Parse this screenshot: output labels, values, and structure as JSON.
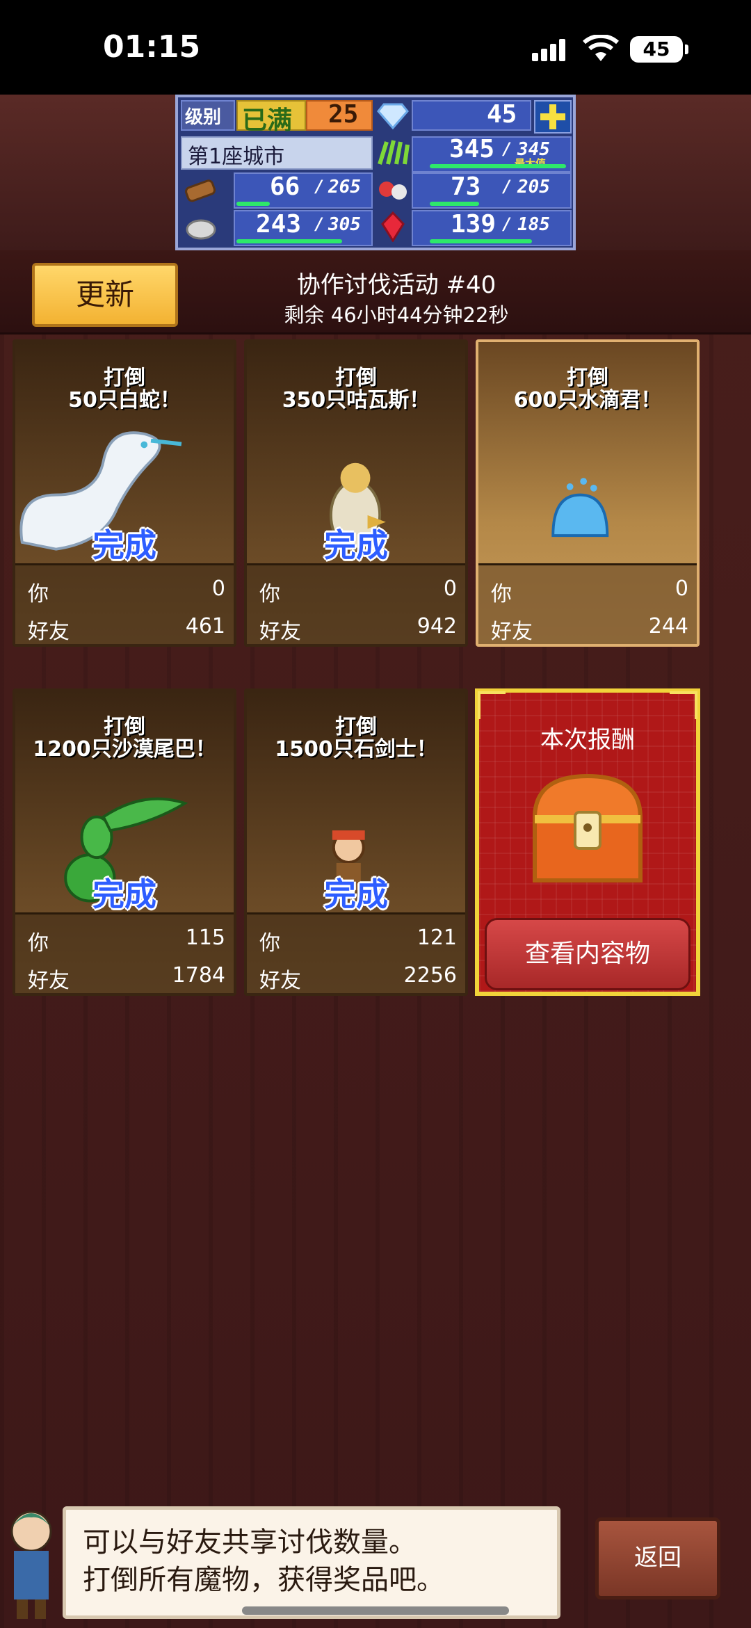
{
  "status_bar": {
    "time": "01:15",
    "battery": "45"
  },
  "resources": {
    "level_label": "级别",
    "level_max_label": "已满",
    "level_value": "25",
    "gems": "45",
    "city_name": "第1座城市",
    "food": {
      "value": "345",
      "max": "345",
      "max_label": "最大值",
      "fill": 1.0
    },
    "wood": {
      "value": "66",
      "max": "265",
      "fill": 0.25
    },
    "fruit": {
      "value": "73",
      "max": "205",
      "fill": 0.36
    },
    "stone": {
      "value": "243",
      "max": "305",
      "fill": 0.8
    },
    "crystal": {
      "value": "139",
      "max": "185",
      "fill": 0.75
    }
  },
  "event": {
    "refresh_label": "更新",
    "title": "协作讨伐活动 #40",
    "timer": "剩余 46小时44分钟22秒"
  },
  "cards": [
    {
      "line1": "打倒",
      "line2": "50只白蛇！",
      "done": "完成",
      "you_label": "你",
      "you": "0",
      "friend_label": "好友",
      "friend": "461"
    },
    {
      "line1": "打倒",
      "line2": "350只咕瓦斯！",
      "done": "完成",
      "you_label": "你",
      "you": "0",
      "friend_label": "好友",
      "friend": "942"
    },
    {
      "line1": "打倒",
      "line2": "600只水滴君！",
      "done": "",
      "you_label": "你",
      "you": "0",
      "friend_label": "好友",
      "friend": "244"
    },
    {
      "line1": "打倒",
      "line2": "1200只沙漠尾巴！",
      "done": "完成",
      "you_label": "你",
      "you": "115",
      "friend_label": "好友",
      "friend": "1784"
    },
    {
      "line1": "打倒",
      "line2": "1500只石剑士！",
      "done": "完成",
      "you_label": "你",
      "you": "121",
      "friend_label": "好友",
      "friend": "2256"
    }
  ],
  "reward": {
    "title": "本次报酬",
    "button": "查看内容物"
  },
  "message": {
    "line1": "可以与好友共享讨伐数量。",
    "line2": "打倒所有魔物，获得奖品吧。"
  },
  "back_label": "返回",
  "colors": {
    "accent_blue": "#2d5dff",
    "reward_red": "#b01818",
    "gold": "#f1d33a"
  }
}
